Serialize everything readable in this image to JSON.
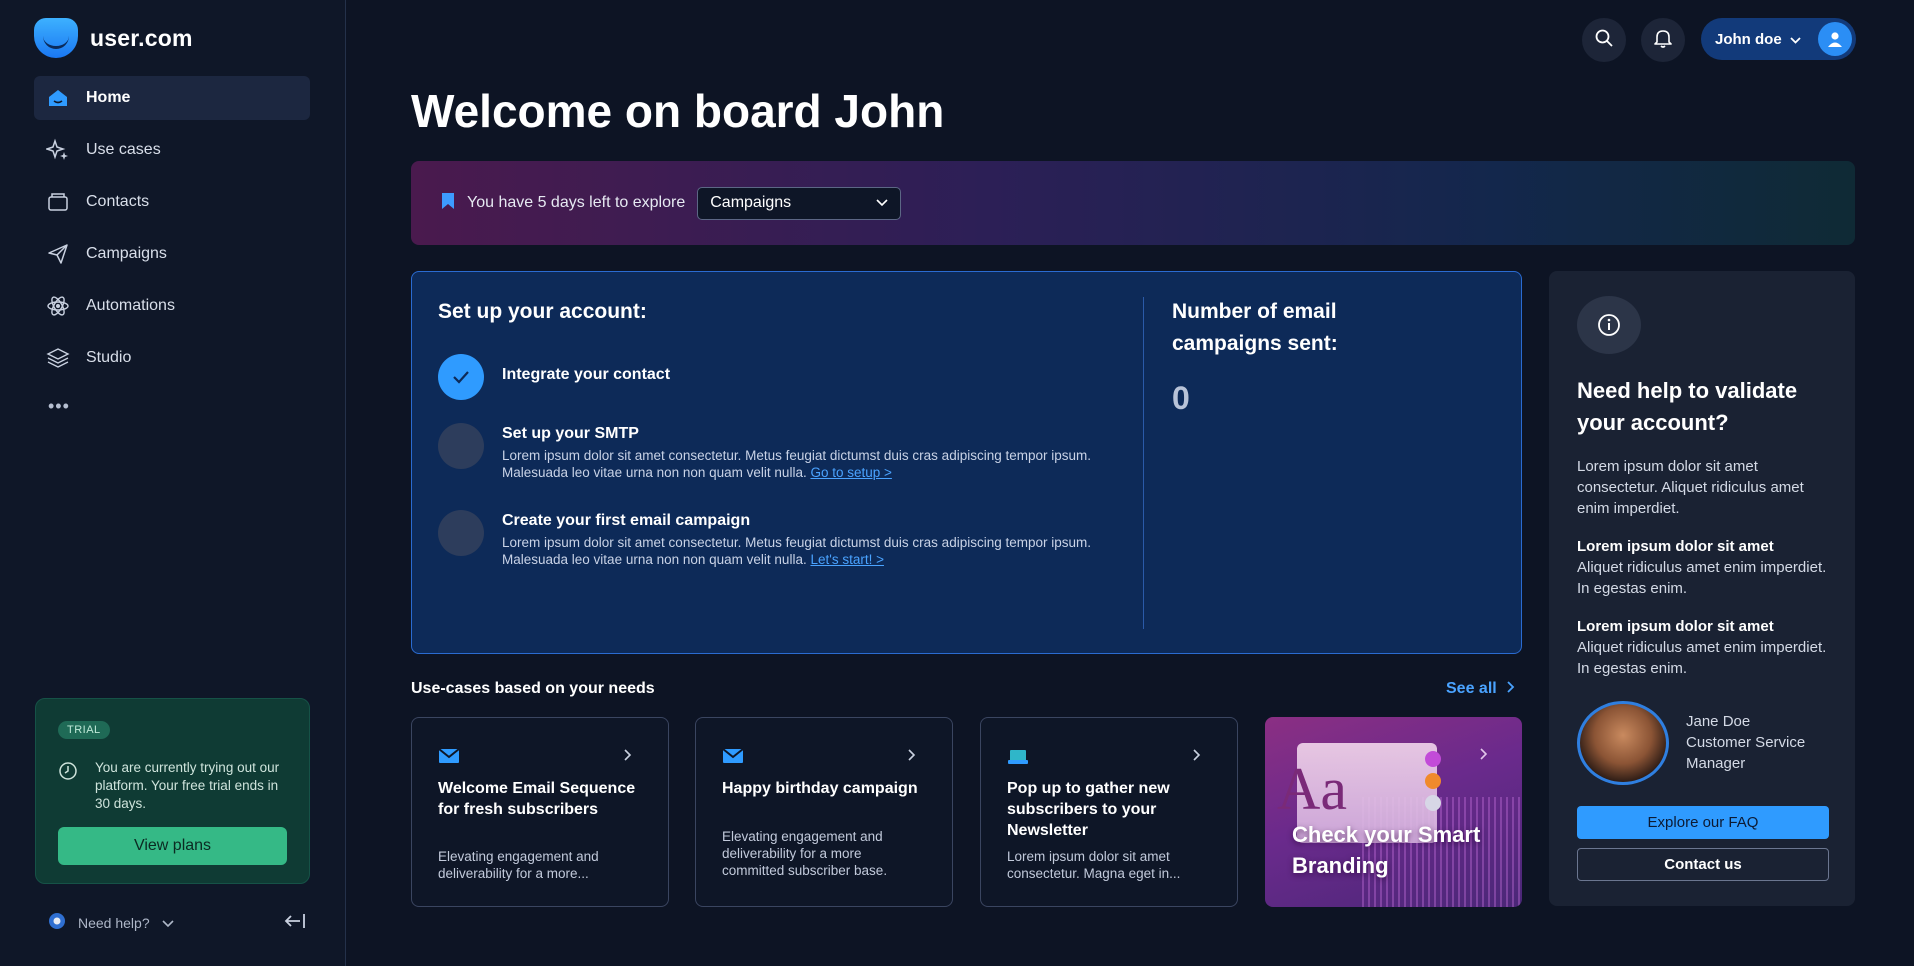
{
  "brand": {
    "name": "user.com"
  },
  "sidebar": {
    "items": [
      {
        "label": "Home",
        "icon": "home-icon",
        "active": true
      },
      {
        "label": "Use cases",
        "icon": "sparkles-icon"
      },
      {
        "label": "Contacts",
        "icon": "contacts-icon"
      },
      {
        "label": "Campaigns",
        "icon": "paper-plane-icon"
      },
      {
        "label": "Automations",
        "icon": "atom-icon"
      },
      {
        "label": "Studio",
        "icon": "layers-icon"
      }
    ],
    "more": "•••",
    "trial": {
      "badge": "TRIAL",
      "text": "You are currently trying out our platform. Your free trial ends in 30 days.",
      "button": "View plans"
    },
    "help": "Need help?"
  },
  "header": {
    "user_name": "John doe"
  },
  "page": {
    "title": "Welcome on board John"
  },
  "banner": {
    "text": "You have 5 days left to explore",
    "select_value": "Campaigns"
  },
  "setup": {
    "title": "Set up your account:",
    "steps": [
      {
        "title": "Integrate your contact",
        "done": true
      },
      {
        "title": "Set up your SMTP",
        "desc": "Lorem ipsum dolor sit amet consectetur. Metus feugiat dictumst duis cras adipiscing tempor ipsum. Malesuada leo vitae urna non non quam velit nulla.",
        "link": "Go to setup >"
      },
      {
        "title": "Create your first email campaign",
        "desc": "Lorem ipsum dolor sit amet consectetur. Metus feugiat dictumst duis cras adipiscing tempor ipsum. Malesuada leo vitae urna non non quam velit nulla.",
        "link": "Let's start! >"
      }
    ],
    "stat_title": "Number of email campaigns sent:",
    "stat_value": "0"
  },
  "help_card": {
    "title": "Need help to validate your account?",
    "p1": "Lorem ipsum dolor sit amet consectetur. Aliquet ridiculus amet enim imperdiet.",
    "p2_bold": "Lorem ipsum dolor sit amet",
    "p2": "Aliquet ridiculus amet enim imperdiet. In egestas enim.",
    "p3_bold": "Lorem ipsum dolor sit amet",
    "p3": "Aliquet ridiculus amet enim imperdiet. In egestas enim.",
    "agent_name": "Jane Doe",
    "agent_role": "Customer Service Manager",
    "faq_button": "Explore our FAQ",
    "contact_button": "Contact us"
  },
  "use_cases": {
    "header": "Use-cases based on your needs",
    "see_all": "See all",
    "cards": [
      {
        "title": "Welcome Email Sequence for fresh subscribers",
        "desc": "Elevating engagement and deliverability for a more...",
        "icon": "mail-icon"
      },
      {
        "title": "Happy birthday campaign",
        "desc": "Elevating engagement and deliverability for a more committed subscriber base.",
        "icon": "mail-icon"
      },
      {
        "title": "Pop up to gather new subscribers to your Newsletter",
        "desc": "Lorem ipsum dolor sit amet consectetur. Magna eget in...",
        "icon": "popup-icon"
      }
    ],
    "promo": {
      "text": "Check your Smart Branding"
    }
  },
  "colors": {
    "accent": "#2f9bff",
    "trial_bg": "#0f3b34",
    "trial_button": "#35b986",
    "setup_bg": "#0d2a58"
  }
}
